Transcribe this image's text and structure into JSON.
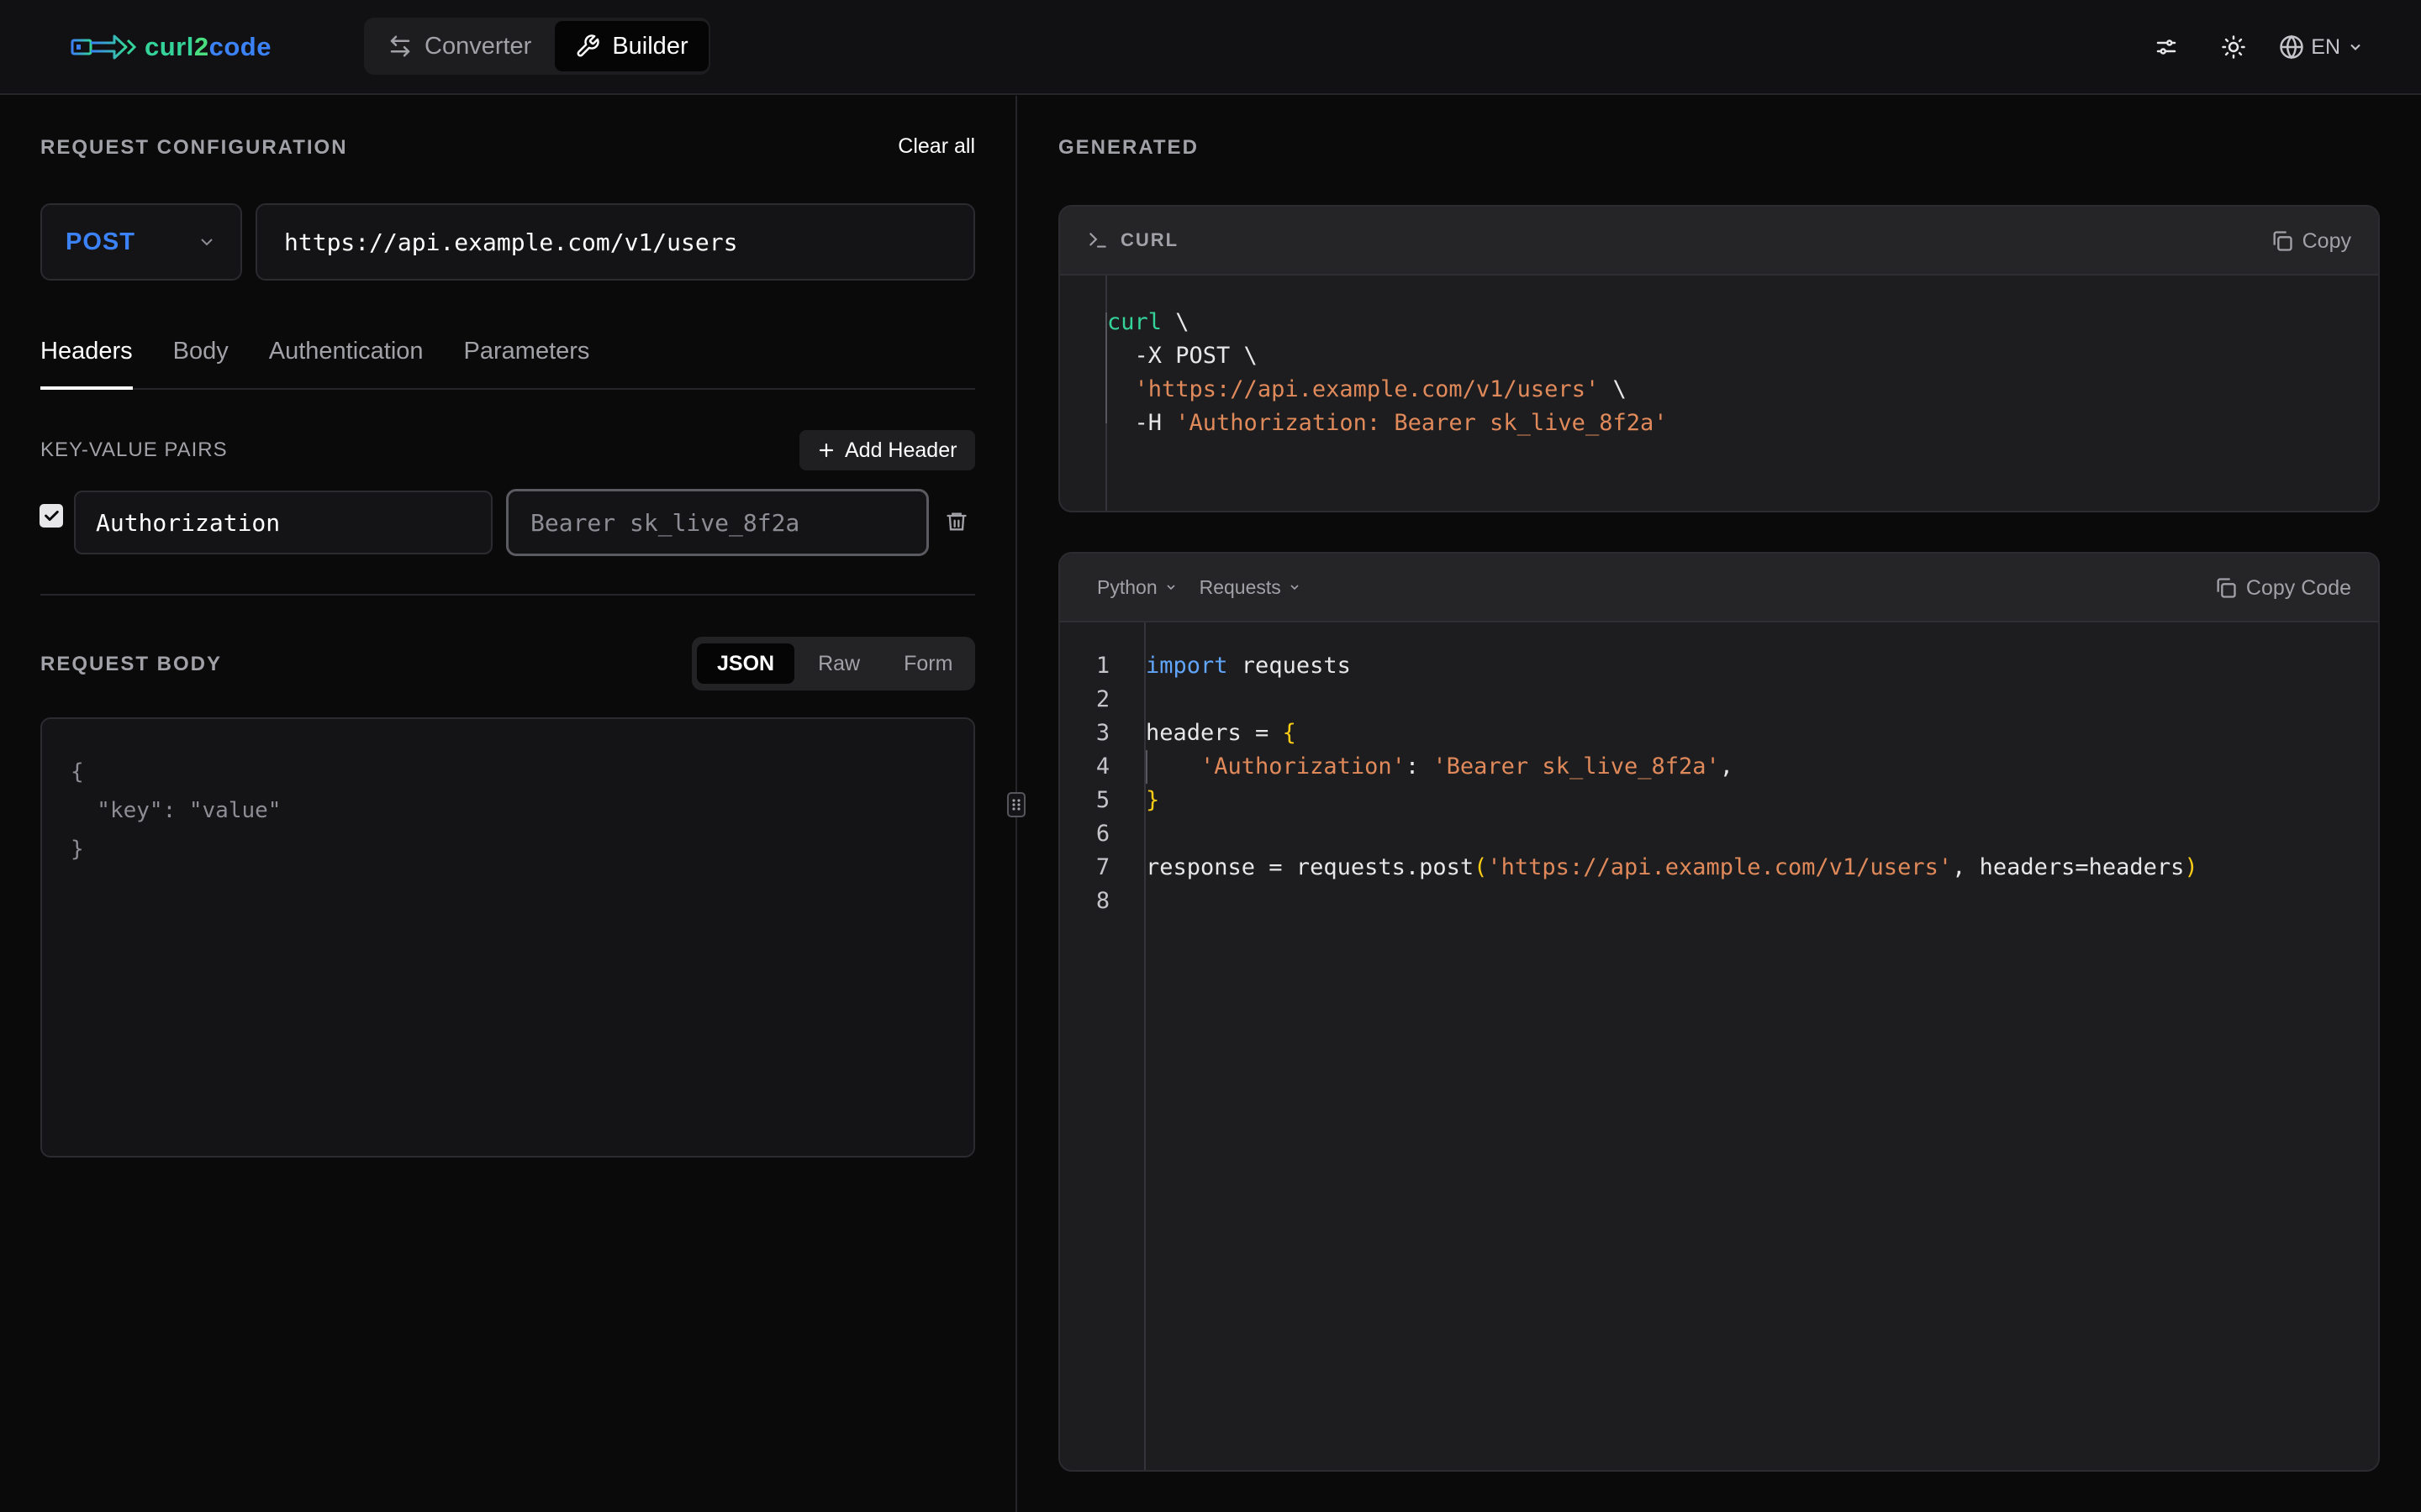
{
  "header": {
    "logo": {
      "part1": "curl",
      "part2": "2",
      "part3": "code"
    },
    "modes": [
      {
        "label": "Converter",
        "icon": "arrows-swap-icon",
        "active": false
      },
      {
        "label": "Builder",
        "icon": "wrench-icon",
        "active": true
      }
    ],
    "settings_icon": "sliders-icon",
    "theme_icon": "sun-icon",
    "language": "EN"
  },
  "request": {
    "section_title": "REQUEST CONFIGURATION",
    "clear_all": "Clear all",
    "method": "POST",
    "url": "https://api.example.com/v1/users",
    "tabs": [
      "Headers",
      "Body",
      "Authentication",
      "Parameters"
    ],
    "active_tab": "Headers",
    "kv_title": "KEY-VALUE PAIRS",
    "add_header": "Add Header",
    "headers": [
      {
        "enabled": true,
        "key": "Authorization",
        "value": "Bearer sk_live_8f2a"
      }
    ]
  },
  "body": {
    "section_title": "REQUEST BODY",
    "formats": [
      "JSON",
      "Raw",
      "Form"
    ],
    "active_format": "JSON",
    "content": "{\n  \"key\": \"value\"\n}"
  },
  "generated": {
    "section_title": "GENERATED",
    "curl": {
      "label": "CURL",
      "copy": "Copy",
      "lines": [
        {
          "parts": [
            {
              "t": "curl",
              "c": "kw-curl"
            },
            {
              "t": " \\",
              "c": ""
            }
          ]
        },
        {
          "parts": [
            {
              "t": "  -X POST \\",
              "c": ""
            }
          ]
        },
        {
          "parts": [
            {
              "t": "  ",
              "c": ""
            },
            {
              "t": "'https://api.example.com/v1/users'",
              "c": "str"
            },
            {
              "t": " \\",
              "c": ""
            }
          ]
        },
        {
          "parts": [
            {
              "t": "  -H ",
              "c": ""
            },
            {
              "t": "'Authorization: Bearer sk_live_8f2a'",
              "c": "str"
            }
          ]
        }
      ]
    },
    "code": {
      "language": "Python",
      "library": "Requests",
      "copy": "Copy Code",
      "line_numbers": [
        "1",
        "2",
        "3",
        "4",
        "5",
        "6",
        "7",
        "8"
      ],
      "lines": [
        {
          "parts": [
            {
              "t": "import",
              "c": "kw"
            },
            {
              "t": " requests",
              "c": ""
            }
          ]
        },
        {
          "parts": []
        },
        {
          "parts": [
            {
              "t": "headers = ",
              "c": ""
            },
            {
              "t": "{",
              "c": "brace"
            }
          ]
        },
        {
          "parts": [
            {
              "t": "    ",
              "c": ""
            },
            {
              "t": "'Authorization'",
              "c": "str"
            },
            {
              "t": ": ",
              "c": ""
            },
            {
              "t": "'Bearer sk_live_8f2a'",
              "c": "str"
            },
            {
              "t": ",",
              "c": ""
            }
          ]
        },
        {
          "parts": [
            {
              "t": "}",
              "c": "brace"
            }
          ]
        },
        {
          "parts": []
        },
        {
          "parts": [
            {
              "t": "response = requests.post",
              "c": ""
            },
            {
              "t": "(",
              "c": "brace"
            },
            {
              "t": "'https://api.example.com/v1/users'",
              "c": "str"
            },
            {
              "t": ", headers=headers",
              "c": ""
            },
            {
              "t": ")",
              "c": "brace"
            }
          ]
        },
        {
          "parts": []
        }
      ]
    }
  },
  "colors": {
    "accent_blue": "#3b82f6",
    "accent_green": "#34d399",
    "string": "#e0895a",
    "keyword": "#60a5fa",
    "brace": "#facc15"
  }
}
